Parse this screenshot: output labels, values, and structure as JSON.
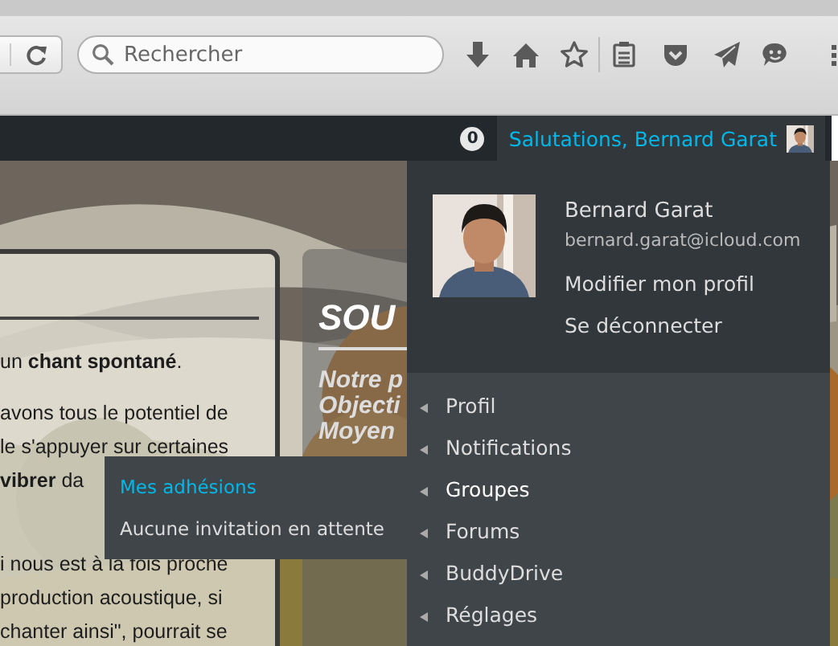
{
  "browser": {
    "search": {
      "placeholder": "Rechercher"
    }
  },
  "admin_bar": {
    "notification_count": "0",
    "greeting": "Salutations, Bernard Garat"
  },
  "page": {
    "left_card": {
      "paragraphs": [
        [
          "un **chant spontané**."
        ],
        [
          "avons tous le potentiel de",
          "le s'appuyer sur certaines",
          "**vibrer** da"
        ],
        [
          "i nous est à la fois proche",
          "production acoustique, si",
          "chanter ainsi\", pourrait se"
        ]
      ]
    },
    "right_card": {
      "heading": "SOU",
      "lines": [
        "Notre p",
        "Objecti",
        "Moyen"
      ]
    }
  },
  "account_menu": {
    "name": "Bernard Garat",
    "email": "bernard.garat@icloud.com",
    "links": [
      "Modifier mon profil",
      "Se déconnecter"
    ],
    "items": [
      {
        "label": "Profil",
        "expanded": false
      },
      {
        "label": "Notifications",
        "expanded": false
      },
      {
        "label": "Groupes",
        "expanded": true,
        "children": [
          {
            "label": "Mes adhésions",
            "selected": true
          },
          {
            "label": "Aucune invitation en attente",
            "selected": false
          }
        ]
      },
      {
        "label": "Forums",
        "expanded": false
      },
      {
        "label": "BuddyDrive",
        "expanded": false
      },
      {
        "label": "Réglages",
        "expanded": false
      }
    ]
  }
}
